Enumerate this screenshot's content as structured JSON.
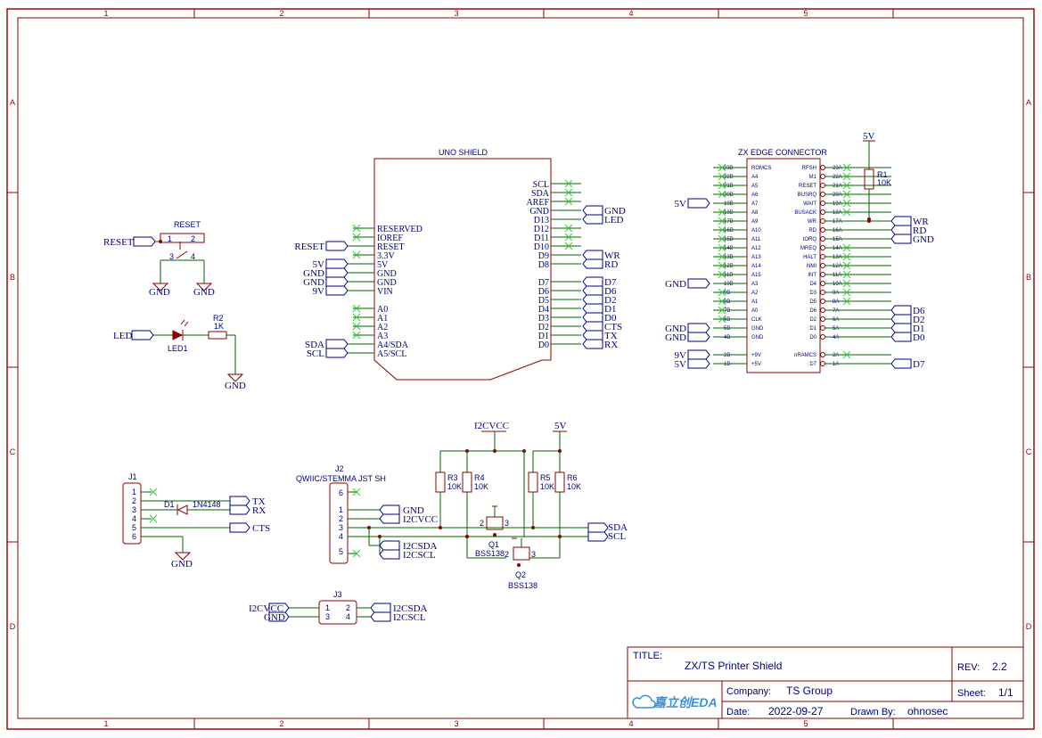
{
  "border": {
    "columns": [
      "1",
      "2",
      "3",
      "4",
      "5"
    ],
    "rows": [
      "A",
      "B",
      "C",
      "D"
    ]
  },
  "reset_switch": {
    "title": "RESET",
    "net": "RESET",
    "pins": [
      "1",
      "2",
      "3",
      "4"
    ],
    "gnd": "GND"
  },
  "led": {
    "net": "LED",
    "ref": "LED1",
    "r_ref": "R2",
    "r_val": "1K",
    "gnd": "GND"
  },
  "uno_shield": {
    "title": "UNO SHIELD",
    "left_pins": [
      "RESERVED",
      "IOREF",
      "RESET",
      "3.3V",
      "5V",
      "GND",
      "GND",
      "VIN",
      "A0",
      "A1",
      "A2",
      "A3",
      "A4/SDA",
      "A5/SCL"
    ],
    "right_pins": [
      "SCL",
      "SDA",
      "AREF",
      "GND",
      "D13",
      "D12",
      "D11",
      "D10",
      "D9",
      "D8",
      "D7",
      "D6",
      "D5",
      "D4",
      "D3",
      "D2",
      "D1",
      "D0"
    ],
    "left_nets": [
      "RESET",
      "5V",
      "GND",
      "GND",
      "9V",
      "SDA",
      "SCL"
    ],
    "right_nets": [
      "GND",
      "LED",
      "WR",
      "RD",
      "D7",
      "D6",
      "D2",
      "D1",
      "D0",
      "CTS",
      "TX",
      "RX"
    ]
  },
  "edge": {
    "title": "ZX EDGE CONNECTOR",
    "left_labels": [
      "ROMCS",
      "A4",
      "A5",
      "A6",
      "A7",
      "A8",
      "A9",
      "A10",
      "A11",
      "A12",
      "A13",
      "A14",
      "A15",
      "A3",
      "A2",
      "A1",
      "A0",
      "CLK",
      "GND",
      "GND",
      "+9V",
      "+5V"
    ],
    "left_nums": [
      "23B",
      "22B",
      "21B",
      "20B",
      "19B",
      "18B",
      "17B",
      "16B",
      "15B",
      "14B",
      "13B",
      "12B",
      "11B",
      "10B",
      "9B",
      "8B",
      "7B",
      "6B",
      "5B",
      "4B",
      "2B",
      "1B"
    ],
    "right_labels": [
      "RFSH",
      "M1",
      "RESET",
      "BUSRQ",
      "WAIT",
      "BUSACK",
      "WR",
      "RD",
      "IORQ",
      "MREQ",
      "HALT",
      "NMI",
      "INT",
      "D4",
      "D3",
      "D5",
      "D6",
      "D2",
      "D1",
      "D0",
      "nRAMCS",
      "D7"
    ],
    "right_nums": [
      "23A",
      "22A",
      "21A",
      "20A",
      "19A",
      "18A",
      "17A",
      "16A",
      "15A",
      "14A",
      "13A",
      "12A",
      "11A",
      "10A",
      "9A",
      "8A",
      "7A",
      "6A",
      "5A",
      "4A",
      "2A",
      "1A"
    ],
    "left_nets": [
      "5V",
      "GND",
      "GND",
      "GND",
      "9V",
      "5V"
    ],
    "right_nets": [
      "WR",
      "RD",
      "GND",
      "D6",
      "D2",
      "D1",
      "D0",
      "D7"
    ],
    "r_ref": "R1",
    "r_val": "10K",
    "pwr": "5V"
  },
  "j1": {
    "ref": "J1",
    "pins": [
      "1",
      "2",
      "3",
      "4",
      "5",
      "6"
    ],
    "diode_ref": "D1",
    "diode_val": "1N4148",
    "nets": [
      "TX",
      "RX",
      "CTS"
    ],
    "gnd": "GND"
  },
  "j2": {
    "ref": "J2",
    "title": "QWIIC/STEMMA JST SH",
    "pins": [
      "6",
      "1",
      "2",
      "3",
      "4",
      "5"
    ],
    "nets": [
      "GND",
      "I2CVCC",
      "I2CSDA",
      "I2CSCL"
    ]
  },
  "level_shift": {
    "pwr_left": "I2CVCC",
    "pwr_right": "5V",
    "resistors": [
      {
        "ref": "R3",
        "val": "10K"
      },
      {
        "ref": "R4",
        "val": "10K"
      },
      {
        "ref": "R5",
        "val": "10K"
      },
      {
        "ref": "R6",
        "val": "10K"
      }
    ],
    "q1_ref": "Q1",
    "q1_val": "BSS138",
    "q2_ref": "Q2",
    "q2_val": "BSS138",
    "q_pins": [
      "2",
      "3"
    ],
    "nets": [
      "SDA",
      "SCL"
    ]
  },
  "j3": {
    "ref": "J3",
    "pins": [
      "1",
      "2",
      "3",
      "4"
    ],
    "left_nets": [
      "I2CVCC",
      "GND"
    ],
    "right_nets": [
      "I2CSDA",
      "I2CSCL"
    ]
  },
  "title_block": {
    "title_label": "TITLE:",
    "title": "ZX/TS Printer Shield",
    "rev_label": "REV:",
    "rev": "2.2",
    "company_label": "Company:",
    "company": "TS Group",
    "sheet_label": "Sheet:",
    "sheet": "1/1",
    "date_label": "Date:",
    "date": "2022-09-27",
    "drawn_label": "Drawn By:",
    "drawn": "ohnosec",
    "logo_text": "嘉立创EDA"
  }
}
